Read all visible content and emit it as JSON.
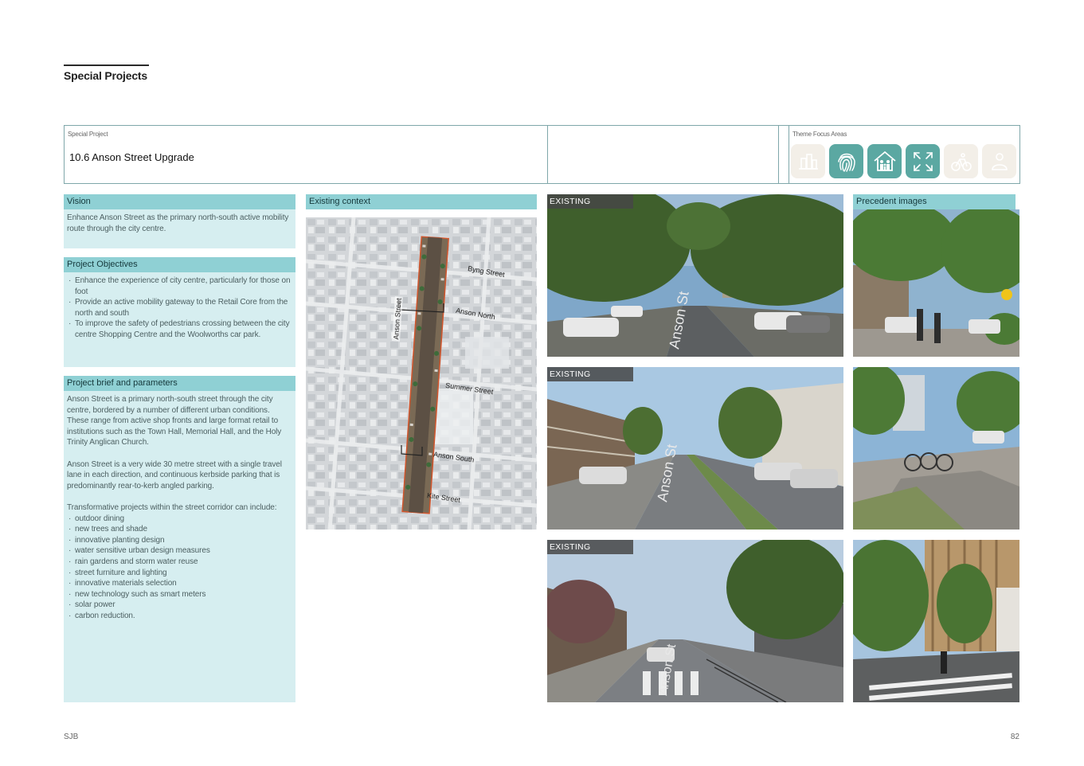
{
  "page": {
    "title": "Special Projects",
    "footer_left": "SJB",
    "page_number": "82"
  },
  "header": {
    "special_project_label": "Special Project",
    "project_title": "10.6  Anson Street Upgrade",
    "theme_label": "Theme Focus Areas",
    "theme_icons": [
      {
        "name": "city-icon",
        "active": false
      },
      {
        "name": "fingerprint-icon",
        "active": true
      },
      {
        "name": "community-house-icon",
        "active": true
      },
      {
        "name": "expand-arrows-icon",
        "active": true
      },
      {
        "name": "cycling-icon",
        "active": false
      },
      {
        "name": "person-icon",
        "active": false
      }
    ]
  },
  "vision": {
    "title": "Vision",
    "text": "Enhance Anson Street as the primary north-south active mobility route through the city centre."
  },
  "objectives": {
    "title": "Project Objectives",
    "items": [
      "Enhance the experience of city centre, particularly for those on foot",
      "Provide an active mobility gateway to the Retail Core from the north and south",
      "To improve the safety of pedestrians crossing between the city centre Shopping Centre and the Woolworths car park."
    ]
  },
  "brief": {
    "title": "Project brief and parameters",
    "para1": "Anson Street is a primary north-south street through the city centre, bordered by a number of different urban conditions. These range from active shop fronts and large format retail to institutions such as the Town Hall, Memorial Hall, and the Holy Trinity Anglican Church.",
    "para2": "Anson Street is a very wide 30 metre street with a single travel lane in each direction, and continuous kerbside parking that is predominantly rear-to-kerb angled parking.",
    "para3": "Transformative projects within the street corridor can include:",
    "items": [
      "outdoor dining",
      "new trees and shade",
      "innovative planting design",
      "water sensitive urban design measures",
      "rain gardens and storm water reuse",
      "street furniture and lighting",
      "innovative materials selection",
      "new technology such as smart meters",
      "solar power",
      "carbon reduction."
    ]
  },
  "context": {
    "title": "Existing context",
    "labels": {
      "byng": "Byng Street",
      "anson_north": "Anson North",
      "anson_street": "Anson Street",
      "summer": "Summer Street",
      "anson_south": "Anson South",
      "kite": "Kite Street"
    }
  },
  "existing": {
    "tag": "EXISTING",
    "road_text_1": "Anson St",
    "road_text_2": "Anson St",
    "road_text_3": "Anson St"
  },
  "precedent": {
    "title": "Precedent images"
  }
}
